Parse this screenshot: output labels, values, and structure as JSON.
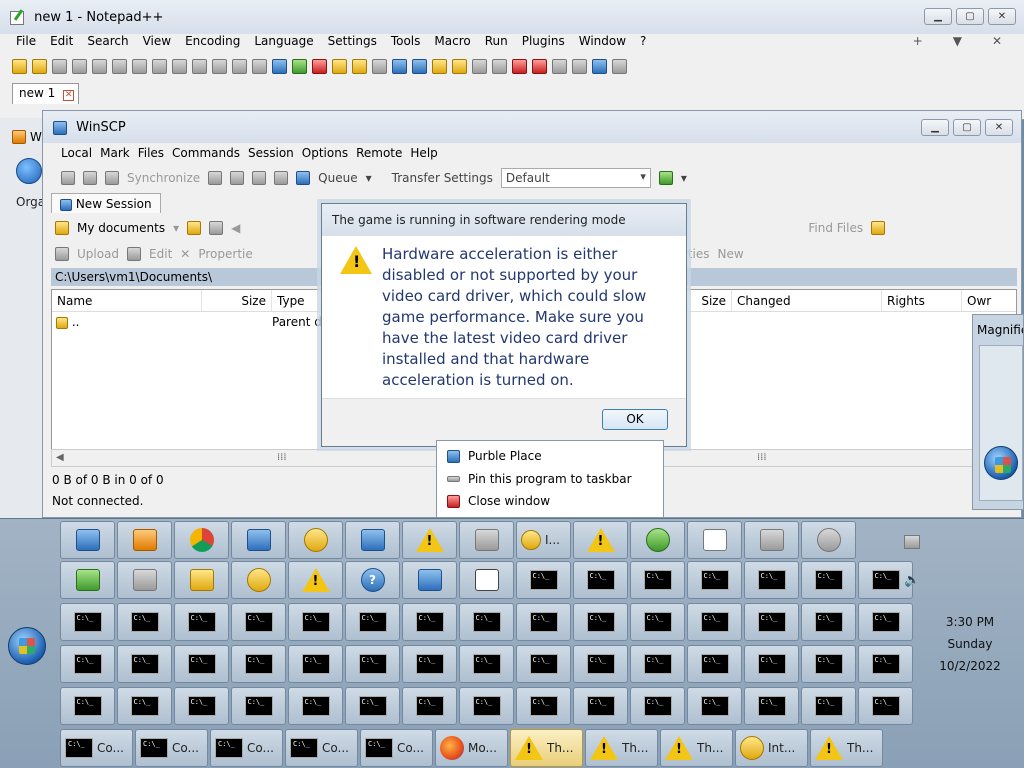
{
  "notepad": {
    "title": "new 1 - Notepad++",
    "menu": [
      "File",
      "Edit",
      "Search",
      "View",
      "Encoding",
      "Language",
      "Settings",
      "Tools",
      "Macro",
      "Run",
      "Plugins",
      "Window",
      "?"
    ],
    "menu_right": [
      "+",
      "▼",
      "✕"
    ],
    "tab": "new 1"
  },
  "bg_window": {
    "title_fragment": "W",
    "label_fragment": "Orga"
  },
  "winscp": {
    "title": "WinSCP",
    "menu": [
      "Local",
      "Mark",
      "Files",
      "Commands",
      "Session",
      "Options",
      "Remote",
      "Help"
    ],
    "synchronize": "Synchronize",
    "queue": "Queue",
    "transfer_settings_label": "Transfer Settings",
    "transfer_settings_value": "Default",
    "new_session": "New Session",
    "my_documents": "My documents",
    "upload": "Upload",
    "edit": "Edit",
    "properties_left": "Propertie",
    "find_files": "Find Files",
    "properties_right": "Properties",
    "new": "New",
    "path": "C:\\Users\\vm1\\Documents\\",
    "left_columns": [
      "Name",
      "Size",
      "Type"
    ],
    "right_columns": [
      "Size",
      "Changed",
      "Rights",
      "Owr"
    ],
    "row_name": "..",
    "row_type": "Parent d",
    "status_bytes": "0 B of 0 B in 0 of 0",
    "status_connection": "Not connected."
  },
  "magnifier": {
    "title": "Magnifie"
  },
  "dialog": {
    "title": "The game is running in software rendering mode",
    "message": "Hardware acceleration is either disabled or not supported by your video card driver, which could slow game performance. Make sure you have the latest video card driver installed and that hardware acceleration is turned on.",
    "ok": "OK"
  },
  "jumplist": {
    "items": [
      "Purble Place",
      "Pin this program to taskbar",
      "Close window"
    ]
  },
  "taskbar": {
    "row6_labels": [
      "Co...",
      "Co...",
      "Co...",
      "Co...",
      "Co...",
      "Mo...",
      "Th...",
      "Th...",
      "Th...",
      "Int...",
      "Th..."
    ],
    "row1_partial_label": "I...",
    "clock_time": "3:30 PM",
    "clock_day": "Sunday",
    "clock_date": "10/2/2022"
  },
  "colors": {
    "accent": "#3c7fb1",
    "warning": "#f3c514",
    "dialog_text": "#223870"
  }
}
